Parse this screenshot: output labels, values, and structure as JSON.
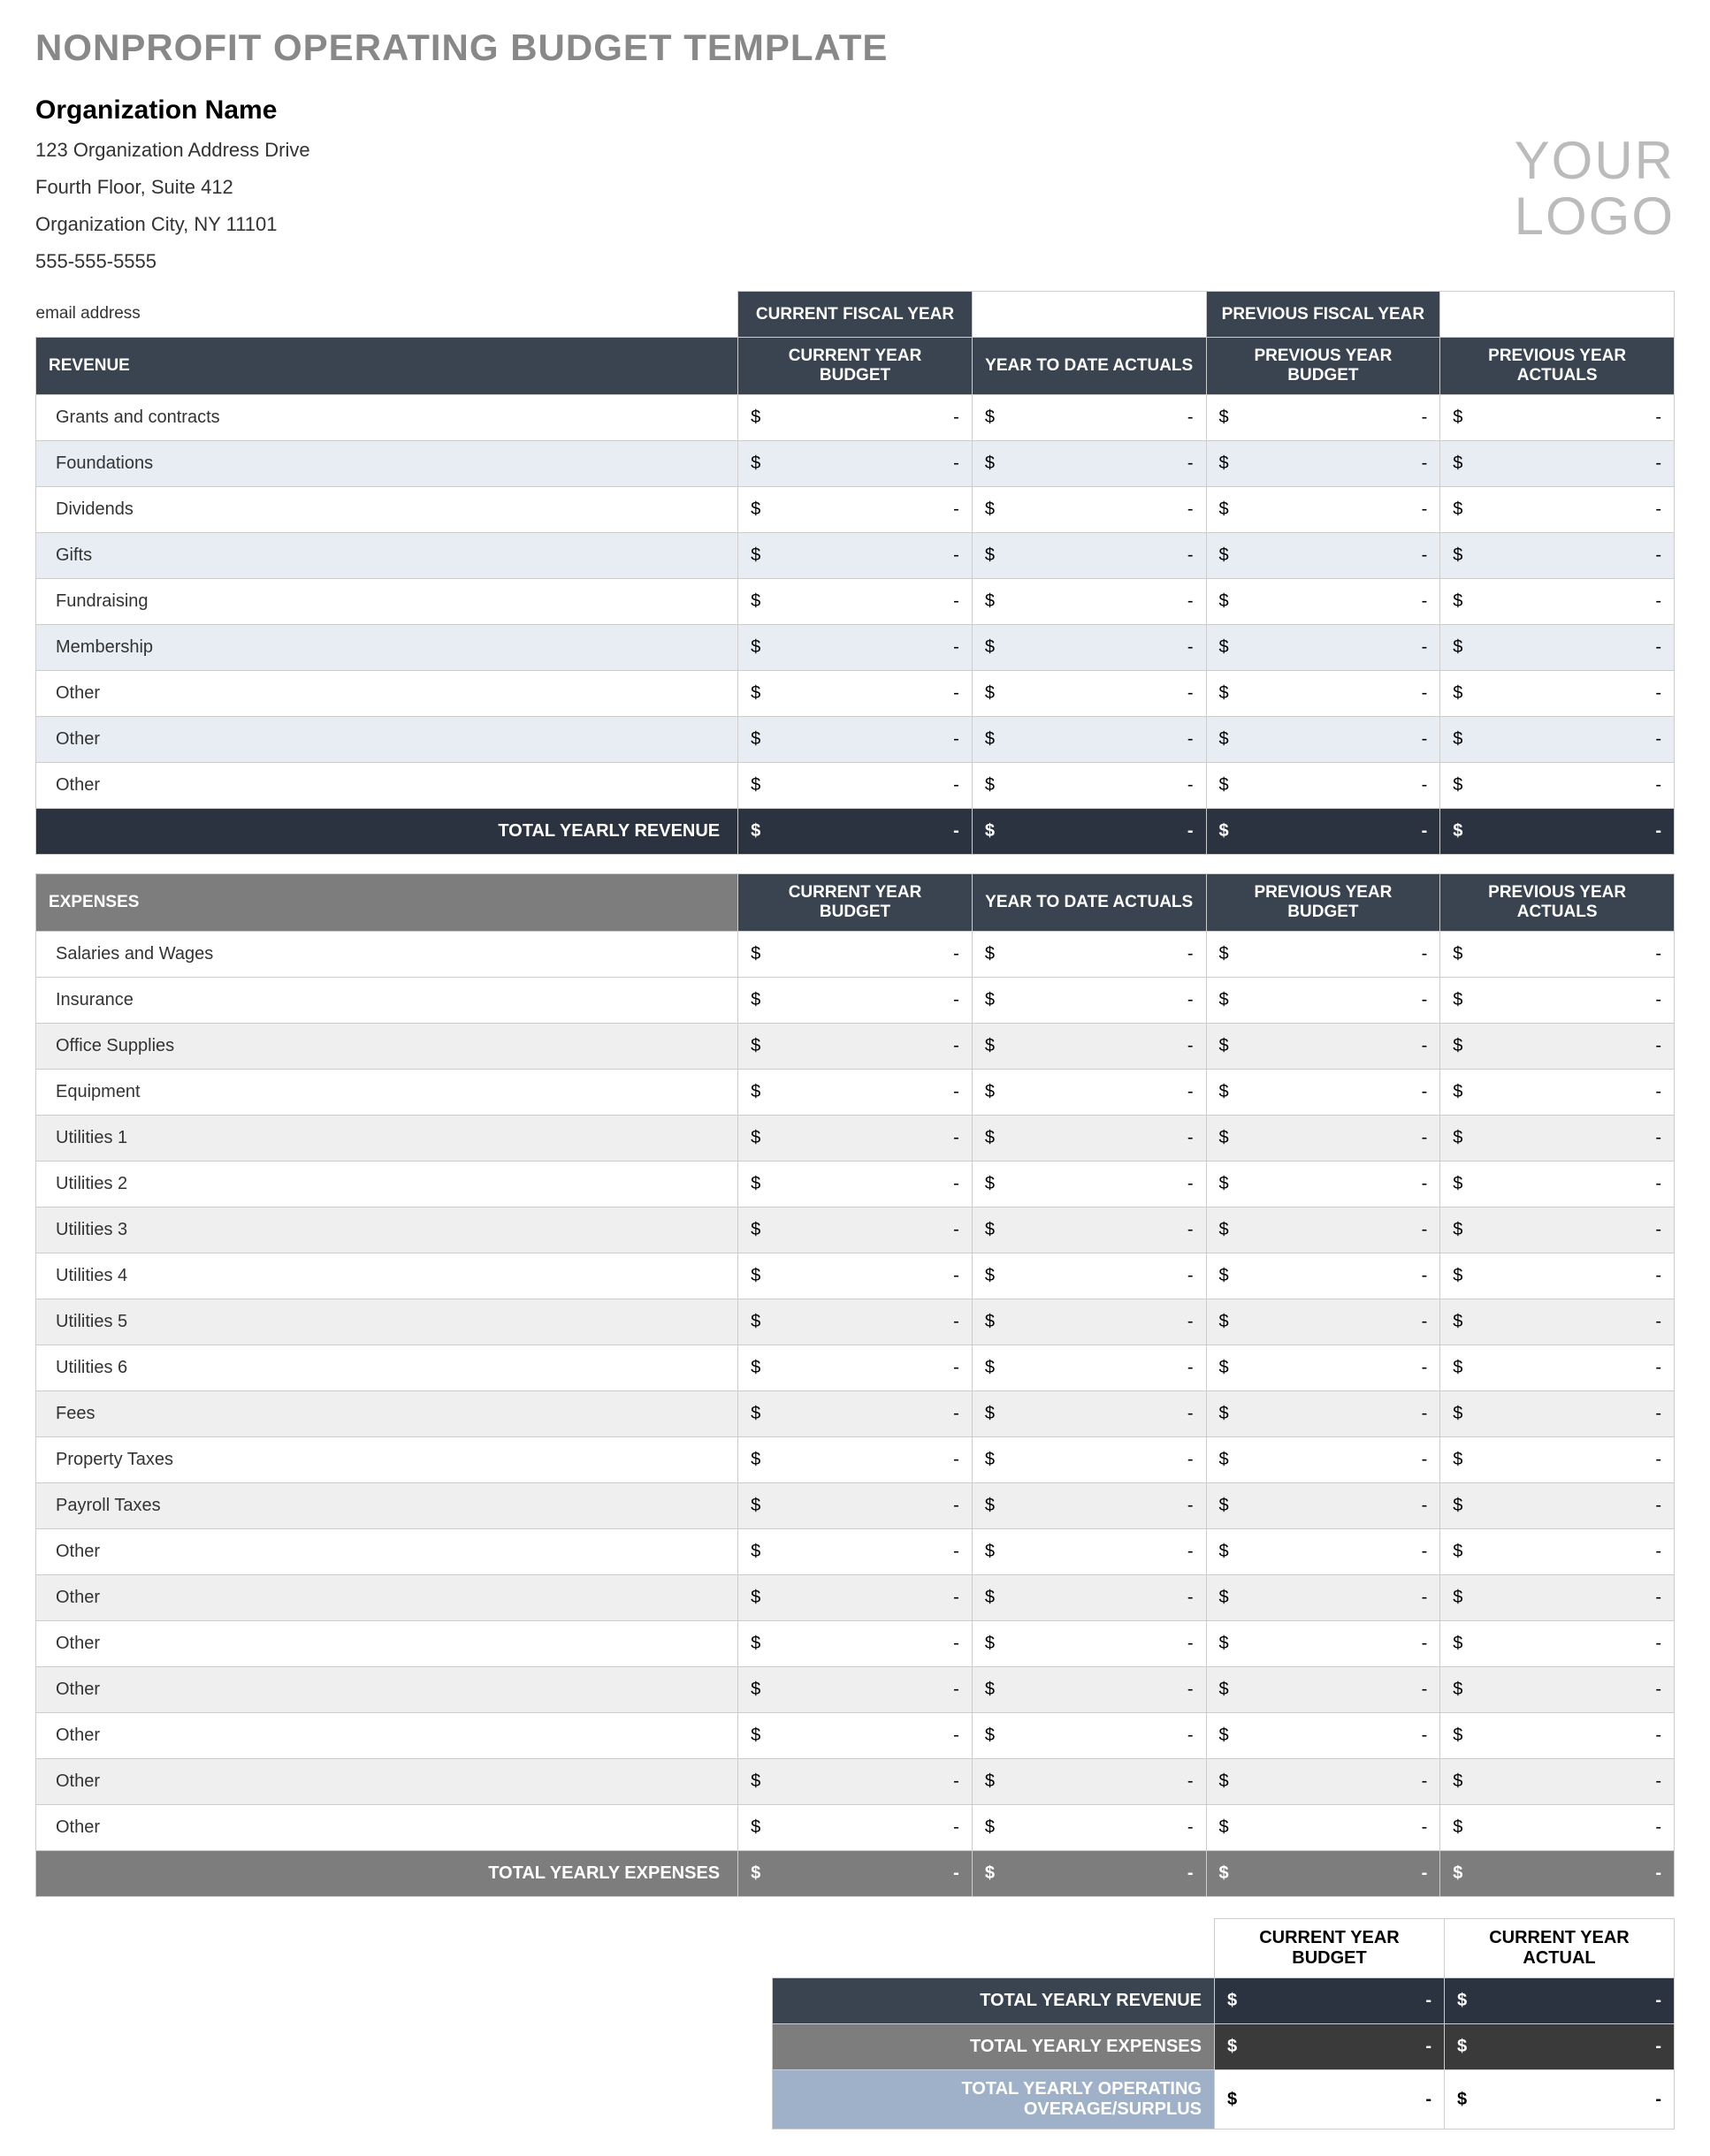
{
  "title": "NONPROFIT OPERATING BUDGET TEMPLATE",
  "org": {
    "name": "Organization Name",
    "line1": "123 Organization Address Drive",
    "line2": "Fourth Floor, Suite 412",
    "line3": "Organization City, NY  11101",
    "phone": "555-555-5555",
    "email": "email address"
  },
  "logo": {
    "line1": "YOUR",
    "line2": "LOGO"
  },
  "fiscal": {
    "current_label": "CURRENT FISCAL YEAR",
    "current_value": "",
    "previous_label": "PREVIOUS FISCAL YEAR",
    "previous_value": ""
  },
  "columns": {
    "c1": "CURRENT YEAR BUDGET",
    "c2": "YEAR TO DATE ACTUALS",
    "c3": "PREVIOUS YEAR BUDGET",
    "c4": "PREVIOUS YEAR ACTUALS"
  },
  "currency": "$",
  "dash": "-",
  "revenue": {
    "header": "REVENUE",
    "rows": [
      {
        "label": "Grants and contracts",
        "v": [
          "-",
          "-",
          "-",
          "-"
        ]
      },
      {
        "label": "Foundations",
        "v": [
          "-",
          "-",
          "-",
          "-"
        ]
      },
      {
        "label": "Dividends",
        "v": [
          "-",
          "-",
          "-",
          "-"
        ]
      },
      {
        "label": "Gifts",
        "v": [
          "-",
          "-",
          "-",
          "-"
        ]
      },
      {
        "label": "Fundraising",
        "v": [
          "-",
          "-",
          "-",
          "-"
        ]
      },
      {
        "label": "Membership",
        "v": [
          "-",
          "-",
          "-",
          "-"
        ]
      },
      {
        "label": "Other",
        "v": [
          "-",
          "-",
          "-",
          "-"
        ]
      },
      {
        "label": "Other",
        "v": [
          "-",
          "-",
          "-",
          "-"
        ]
      },
      {
        "label": "Other",
        "v": [
          "-",
          "-",
          "-",
          "-"
        ]
      }
    ],
    "total_label": "TOTAL YEARLY REVENUE",
    "total": [
      "-",
      "-",
      "-",
      "-"
    ]
  },
  "expenses": {
    "header": "EXPENSES",
    "rows": [
      {
        "label": "Salaries and Wages",
        "v": [
          "-",
          "-",
          "-",
          "-"
        ]
      },
      {
        "label": "Insurance",
        "v": [
          "-",
          "-",
          "-",
          "-"
        ]
      },
      {
        "label": "Office Supplies",
        "v": [
          "-",
          "-",
          "-",
          "-"
        ]
      },
      {
        "label": "Equipment",
        "v": [
          "-",
          "-",
          "-",
          "-"
        ]
      },
      {
        "label": "Utilities 1",
        "v": [
          "-",
          "-",
          "-",
          "-"
        ]
      },
      {
        "label": "Utilities 2",
        "v": [
          "-",
          "-",
          "-",
          "-"
        ]
      },
      {
        "label": "Utilities 3",
        "v": [
          "-",
          "-",
          "-",
          "-"
        ]
      },
      {
        "label": "Utilities 4",
        "v": [
          "-",
          "-",
          "-",
          "-"
        ]
      },
      {
        "label": "Utilities 5",
        "v": [
          "-",
          "-",
          "-",
          "-"
        ]
      },
      {
        "label": "Utilities 6",
        "v": [
          "-",
          "-",
          "-",
          "-"
        ]
      },
      {
        "label": "Fees",
        "v": [
          "-",
          "-",
          "-",
          "-"
        ]
      },
      {
        "label": "Property Taxes",
        "v": [
          "-",
          "-",
          "-",
          "-"
        ]
      },
      {
        "label": "Payroll Taxes",
        "v": [
          "-",
          "-",
          "-",
          "-"
        ]
      },
      {
        "label": "Other",
        "v": [
          "-",
          "-",
          "-",
          "-"
        ]
      },
      {
        "label": "Other",
        "v": [
          "-",
          "-",
          "-",
          "-"
        ]
      },
      {
        "label": "Other",
        "v": [
          "-",
          "-",
          "-",
          "-"
        ]
      },
      {
        "label": "Other",
        "v": [
          "-",
          "-",
          "-",
          "-"
        ]
      },
      {
        "label": "Other",
        "v": [
          "-",
          "-",
          "-",
          "-"
        ]
      },
      {
        "label": "Other",
        "v": [
          "-",
          "-",
          "-",
          "-"
        ]
      },
      {
        "label": "Other",
        "v": [
          "-",
          "-",
          "-",
          "-"
        ]
      }
    ],
    "total_label": "TOTAL YEARLY EXPENSES",
    "total": [
      "-",
      "-",
      "-",
      "-"
    ]
  },
  "summary": {
    "col1": "CURRENT YEAR BUDGET",
    "col2": "CURRENT YEAR ACTUAL",
    "rows": [
      {
        "label": "TOTAL YEARLY REVENUE",
        "v": [
          "-",
          "-"
        ],
        "style": "rev"
      },
      {
        "label": "TOTAL YEARLY EXPENSES",
        "v": [
          "-",
          "-"
        ],
        "style": "exp"
      },
      {
        "label": "TOTAL YEARLY OPERATING OVERAGE/SURPLUS",
        "v": [
          "-",
          "-"
        ],
        "style": "surplus"
      }
    ]
  }
}
